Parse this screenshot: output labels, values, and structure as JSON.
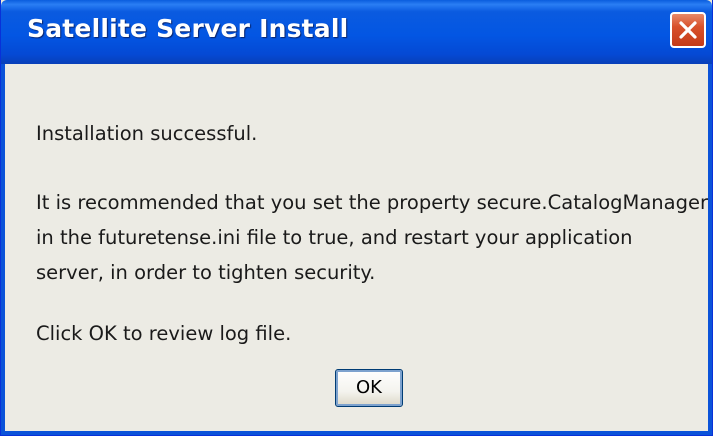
{
  "dialog": {
    "title": "Satellite Server Install",
    "close_icon": "close-icon"
  },
  "message": {
    "line1": "Installation successful.",
    "line2": "It is recommended that you set the property secure.CatalogManager",
    "line3": "in the futuretense.ini file to true, and restart your application",
    "line4": "server, in order to tighten security.",
    "line5": "Click OK to review log file."
  },
  "buttons": {
    "ok_label": "OK"
  },
  "colors": {
    "titlebar": "#0356e3",
    "close_button": "#d8512b",
    "dialog_background": "#ecebe4"
  }
}
